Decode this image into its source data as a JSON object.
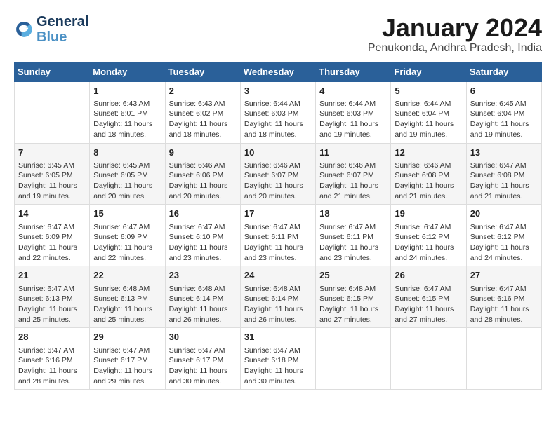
{
  "logo": {
    "line1": "General",
    "line2": "Blue"
  },
  "title": "January 2024",
  "subtitle": "Penukonda, Andhra Pradesh, India",
  "days_of_week": [
    "Sunday",
    "Monday",
    "Tuesday",
    "Wednesday",
    "Thursday",
    "Friday",
    "Saturday"
  ],
  "weeks": [
    [
      {
        "num": "",
        "info": ""
      },
      {
        "num": "1",
        "info": "Sunrise: 6:43 AM\nSunset: 6:01 PM\nDaylight: 11 hours\nand 18 minutes."
      },
      {
        "num": "2",
        "info": "Sunrise: 6:43 AM\nSunset: 6:02 PM\nDaylight: 11 hours\nand 18 minutes."
      },
      {
        "num": "3",
        "info": "Sunrise: 6:44 AM\nSunset: 6:03 PM\nDaylight: 11 hours\nand 18 minutes."
      },
      {
        "num": "4",
        "info": "Sunrise: 6:44 AM\nSunset: 6:03 PM\nDaylight: 11 hours\nand 19 minutes."
      },
      {
        "num": "5",
        "info": "Sunrise: 6:44 AM\nSunset: 6:04 PM\nDaylight: 11 hours\nand 19 minutes."
      },
      {
        "num": "6",
        "info": "Sunrise: 6:45 AM\nSunset: 6:04 PM\nDaylight: 11 hours\nand 19 minutes."
      }
    ],
    [
      {
        "num": "7",
        "info": "Sunrise: 6:45 AM\nSunset: 6:05 PM\nDaylight: 11 hours\nand 19 minutes."
      },
      {
        "num": "8",
        "info": "Sunrise: 6:45 AM\nSunset: 6:05 PM\nDaylight: 11 hours\nand 20 minutes."
      },
      {
        "num": "9",
        "info": "Sunrise: 6:46 AM\nSunset: 6:06 PM\nDaylight: 11 hours\nand 20 minutes."
      },
      {
        "num": "10",
        "info": "Sunrise: 6:46 AM\nSunset: 6:07 PM\nDaylight: 11 hours\nand 20 minutes."
      },
      {
        "num": "11",
        "info": "Sunrise: 6:46 AM\nSunset: 6:07 PM\nDaylight: 11 hours\nand 21 minutes."
      },
      {
        "num": "12",
        "info": "Sunrise: 6:46 AM\nSunset: 6:08 PM\nDaylight: 11 hours\nand 21 minutes."
      },
      {
        "num": "13",
        "info": "Sunrise: 6:47 AM\nSunset: 6:08 PM\nDaylight: 11 hours\nand 21 minutes."
      }
    ],
    [
      {
        "num": "14",
        "info": "Sunrise: 6:47 AM\nSunset: 6:09 PM\nDaylight: 11 hours\nand 22 minutes."
      },
      {
        "num": "15",
        "info": "Sunrise: 6:47 AM\nSunset: 6:09 PM\nDaylight: 11 hours\nand 22 minutes."
      },
      {
        "num": "16",
        "info": "Sunrise: 6:47 AM\nSunset: 6:10 PM\nDaylight: 11 hours\nand 23 minutes."
      },
      {
        "num": "17",
        "info": "Sunrise: 6:47 AM\nSunset: 6:11 PM\nDaylight: 11 hours\nand 23 minutes."
      },
      {
        "num": "18",
        "info": "Sunrise: 6:47 AM\nSunset: 6:11 PM\nDaylight: 11 hours\nand 23 minutes."
      },
      {
        "num": "19",
        "info": "Sunrise: 6:47 AM\nSunset: 6:12 PM\nDaylight: 11 hours\nand 24 minutes."
      },
      {
        "num": "20",
        "info": "Sunrise: 6:47 AM\nSunset: 6:12 PM\nDaylight: 11 hours\nand 24 minutes."
      }
    ],
    [
      {
        "num": "21",
        "info": "Sunrise: 6:47 AM\nSunset: 6:13 PM\nDaylight: 11 hours\nand 25 minutes."
      },
      {
        "num": "22",
        "info": "Sunrise: 6:48 AM\nSunset: 6:13 PM\nDaylight: 11 hours\nand 25 minutes."
      },
      {
        "num": "23",
        "info": "Sunrise: 6:48 AM\nSunset: 6:14 PM\nDaylight: 11 hours\nand 26 minutes."
      },
      {
        "num": "24",
        "info": "Sunrise: 6:48 AM\nSunset: 6:14 PM\nDaylight: 11 hours\nand 26 minutes."
      },
      {
        "num": "25",
        "info": "Sunrise: 6:48 AM\nSunset: 6:15 PM\nDaylight: 11 hours\nand 27 minutes."
      },
      {
        "num": "26",
        "info": "Sunrise: 6:47 AM\nSunset: 6:15 PM\nDaylight: 11 hours\nand 27 minutes."
      },
      {
        "num": "27",
        "info": "Sunrise: 6:47 AM\nSunset: 6:16 PM\nDaylight: 11 hours\nand 28 minutes."
      }
    ],
    [
      {
        "num": "28",
        "info": "Sunrise: 6:47 AM\nSunset: 6:16 PM\nDaylight: 11 hours\nand 28 minutes."
      },
      {
        "num": "29",
        "info": "Sunrise: 6:47 AM\nSunset: 6:17 PM\nDaylight: 11 hours\nand 29 minutes."
      },
      {
        "num": "30",
        "info": "Sunrise: 6:47 AM\nSunset: 6:17 PM\nDaylight: 11 hours\nand 30 minutes."
      },
      {
        "num": "31",
        "info": "Sunrise: 6:47 AM\nSunset: 6:18 PM\nDaylight: 11 hours\nand 30 minutes."
      },
      {
        "num": "",
        "info": ""
      },
      {
        "num": "",
        "info": ""
      },
      {
        "num": "",
        "info": ""
      }
    ]
  ]
}
